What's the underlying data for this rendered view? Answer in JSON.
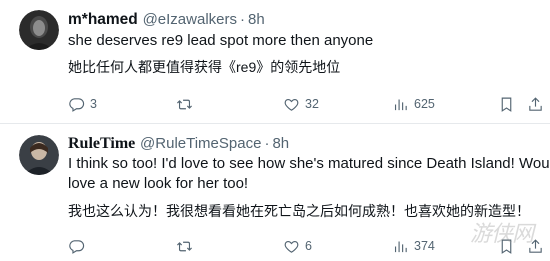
{
  "tweets": [
    {
      "display_name": "m*hamed",
      "handle": "@eIzawalkers",
      "dot": "·",
      "time": "8h",
      "text_en": "she deserves re9 lead spot more then anyone",
      "text_zh": "她比任何人都更值得获得《re9》的领先地位",
      "actions": {
        "reply_count": "3",
        "retweet_count": "",
        "like_count": "32",
        "views_count": "625"
      }
    },
    {
      "display_name": "RuleTime",
      "handle": "@RuleTimeSpace",
      "dot": "·",
      "time": "8h",
      "text_en_1": "I think so too! I'd love to see how she's matured since Death Island! Would",
      "text_en_2": "love a new look for her too!",
      "text_zh": "我也这么认为！我很想看看她在死亡岛之后如何成熟！也喜欢她的新造型！",
      "actions": {
        "reply_count": "",
        "retweet_count": "",
        "like_count": "6",
        "views_count": "374"
      }
    }
  ],
  "watermark": "游侠网",
  "icons": {
    "reply": "reply-icon",
    "retweet": "retweet-icon",
    "like": "heart-icon",
    "views": "views-icon",
    "bookmark": "bookmark-icon",
    "share": "share-icon"
  },
  "colors": {
    "text": "#0f1419",
    "secondary": "#536471",
    "divider": "#e6e9ec"
  }
}
